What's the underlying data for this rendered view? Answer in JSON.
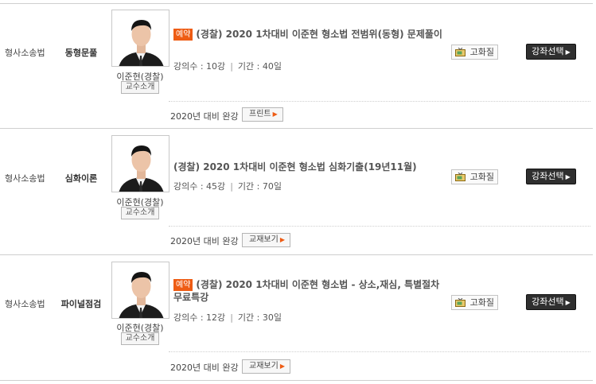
{
  "courses": [
    {
      "subject": "형사소송법",
      "category": "동형문풀",
      "professor": "이준현(경찰)",
      "professor_btn": "교수소개",
      "badge": "예약",
      "title": "(경찰) 2020 1차대비 이준현 형소법 전범위(동형) 문제풀이",
      "lecture_label": "강의수 : 10강",
      "period_label": "기간 : 40일",
      "separator": "|",
      "year_text": "2020년 대비 완강",
      "material_btn": "프린트",
      "review_btn": "고화질",
      "select_btn": "강좌선택"
    },
    {
      "subject": "형사소송법",
      "category": "심화이론",
      "professor": "이준현(경찰)",
      "professor_btn": "교수소개",
      "badge": "",
      "title": "(경찰) 2020 1차대비 이준현 형소법 심화기출(19년11월)",
      "lecture_label": "강의수 : 45강",
      "period_label": "기간 : 70일",
      "separator": "|",
      "year_text": "2020년 대비 완강",
      "material_btn": "교재보기",
      "review_btn": "고화질",
      "select_btn": "강좌선택"
    },
    {
      "subject": "형사소송법",
      "category": "파이널점검",
      "professor": "이준현(경찰)",
      "professor_btn": "교수소개",
      "badge": "예약",
      "title": "(경찰) 2020 1차대비 이준현 형소법 - 상소,재심, 특별절차 무료특강",
      "lecture_label": "강의수 : 12강",
      "period_label": "기간 : 30일",
      "separator": "|",
      "year_text": "2020년 대비 완강",
      "material_btn": "교재보기",
      "review_btn": "고화질",
      "select_btn": "강좌선택"
    }
  ],
  "icons": {
    "review": "tv-icon",
    "arrow": "triangle-right-icon"
  },
  "colors": {
    "badge": "#ee5c14",
    "select_button": "#2f2f2f",
    "arrow": "#ee5c14"
  }
}
